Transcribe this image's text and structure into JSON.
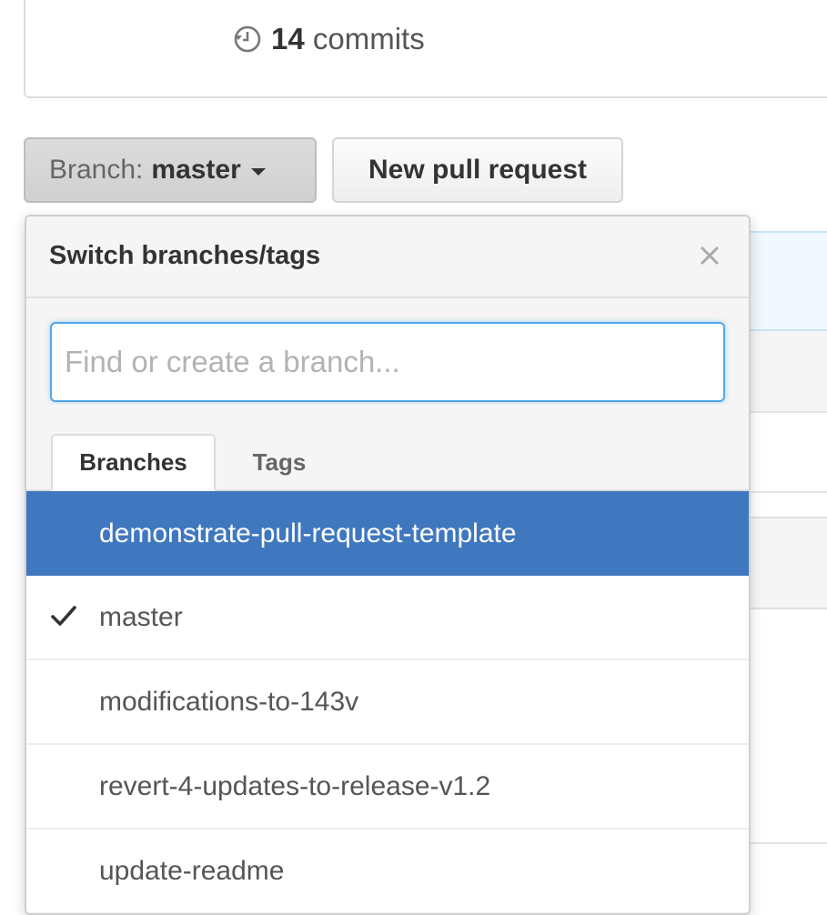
{
  "stats": {
    "commits_count": "14",
    "commits_label": "commits"
  },
  "toolbar": {
    "branch_prefix": "Branch:",
    "branch_name": "master",
    "new_pr_label": "New pull request"
  },
  "dropdown": {
    "title": "Switch branches/tags",
    "search_placeholder": "Find or create a branch...",
    "tabs": [
      {
        "label": "Branches",
        "active": true
      },
      {
        "label": "Tags",
        "active": false
      }
    ],
    "branches": [
      {
        "label": "demonstrate-pull-request-template",
        "highlighted": true,
        "checked": false
      },
      {
        "label": "master",
        "highlighted": false,
        "checked": true
      },
      {
        "label": "modifications-to-143v",
        "highlighted": false,
        "checked": false
      },
      {
        "label": "revert-4-updates-to-release-v1.2",
        "highlighted": false,
        "checked": false
      },
      {
        "label": "update-readme",
        "highlighted": false,
        "checked": false
      }
    ]
  },
  "colors": {
    "highlight": "#4078c0",
    "focus_border": "#51a7e8"
  },
  "icons": {
    "commits": "history-icon",
    "branches": "git-branch-icon",
    "close": "close-icon",
    "check": "check-icon",
    "caret": "caret-down-icon"
  }
}
